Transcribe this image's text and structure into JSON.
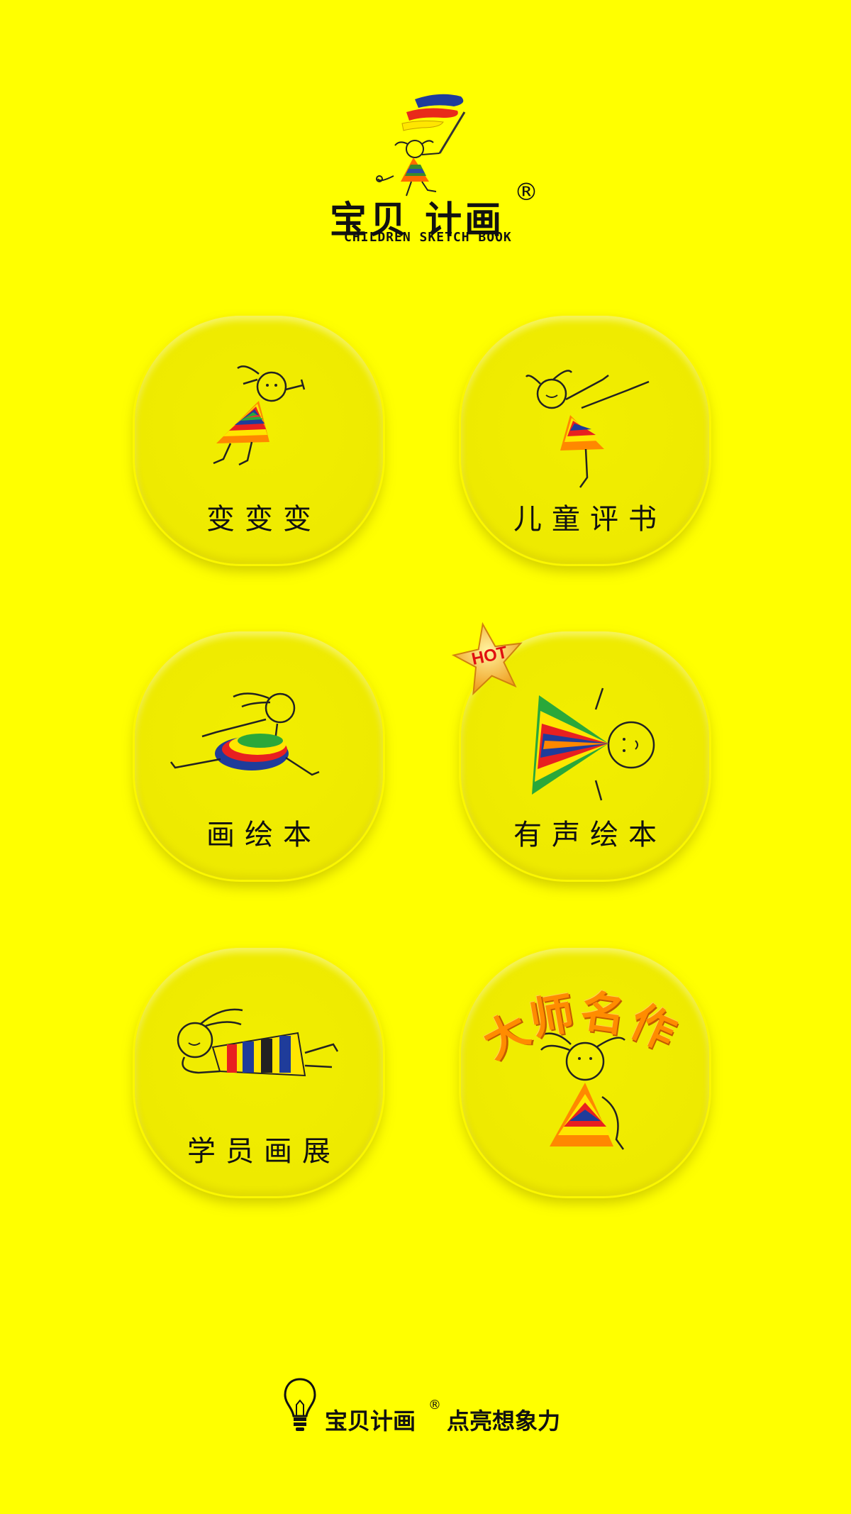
{
  "logo": {
    "title": "宝贝 计画",
    "registered": "®",
    "subtitle": "CHILDREN SKETCH BOOK"
  },
  "tiles": [
    {
      "label": "变变变"
    },
    {
      "label": "儿童评书"
    },
    {
      "label": "画绘本"
    },
    {
      "label": "有声绘本",
      "badge": "HOT"
    },
    {
      "label": "学员画展"
    },
    {
      "label": "",
      "title": "大师名作"
    }
  ],
  "master_title_chars": [
    "大",
    "师",
    "名",
    "作"
  ],
  "footer": {
    "brand": "宝贝计画",
    "registered": "®",
    "slogan": "点亮想象力"
  },
  "colors": {
    "background": "#ffff00",
    "tile": "#eeea00",
    "accent_orange": "#ff8c00",
    "hot_text": "#e01010"
  },
  "icons": [
    "lightbulb-icon",
    "star-badge-icon"
  ]
}
